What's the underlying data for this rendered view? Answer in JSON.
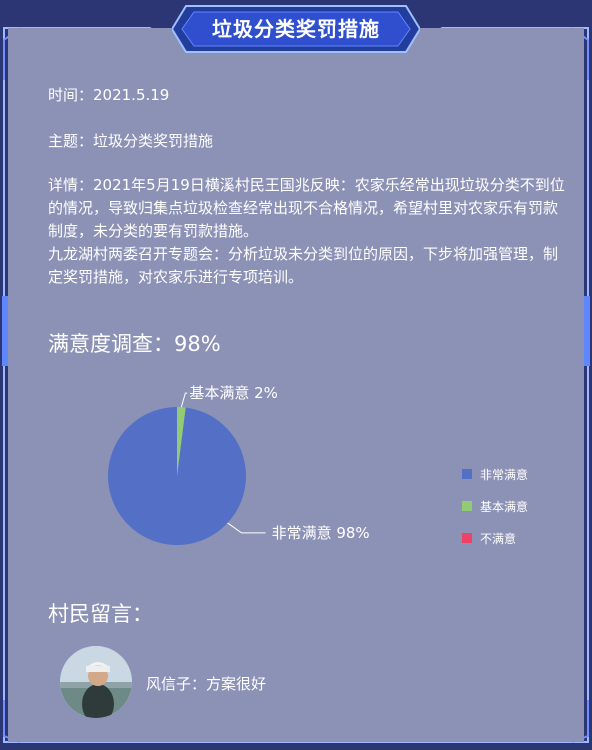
{
  "header": {
    "title": "垃圾分类奖罚措施"
  },
  "info": {
    "time": "时间：2021.5.19",
    "topic": "主题：垃圾分类奖罚措施",
    "details": [
      "详情：2021年5月19日横溪村民王国兆反映：农家乐经常出现垃圾分类不到位的情况，导致归集点垃圾检查经常出现不合格情况，希望村里对农家乐有罚款制度，未分类的要有罚款措施。",
      "九龙湖村两委召开专题会：分析垃圾未分类到位的原因，下步将加强管理，制定奖罚措施，对农家乐进行专项培训。"
    ]
  },
  "survey": {
    "heading": "满意度调查：98%"
  },
  "chart_data": {
    "type": "pie",
    "title": "",
    "categories": [
      "非常满意",
      "基本满意",
      "不满意"
    ],
    "values": [
      98,
      2,
      0
    ],
    "colors": [
      "#5470c6",
      "#91cc75",
      "#ee4266"
    ],
    "labels": [
      "非常满意  98%",
      "基本满意  2%"
    ],
    "legend": {
      "position": "right",
      "items": [
        "非常满意",
        "基本满意",
        "不满意"
      ]
    }
  },
  "comments": {
    "heading": "村民留言：",
    "items": [
      {
        "text": "风信子：方案很好",
        "avatar": "user-avatar-photo"
      }
    ]
  },
  "colors": {
    "panel": "#8c92b6",
    "frame": "#2c3674",
    "accent": "#4f7cf0"
  }
}
